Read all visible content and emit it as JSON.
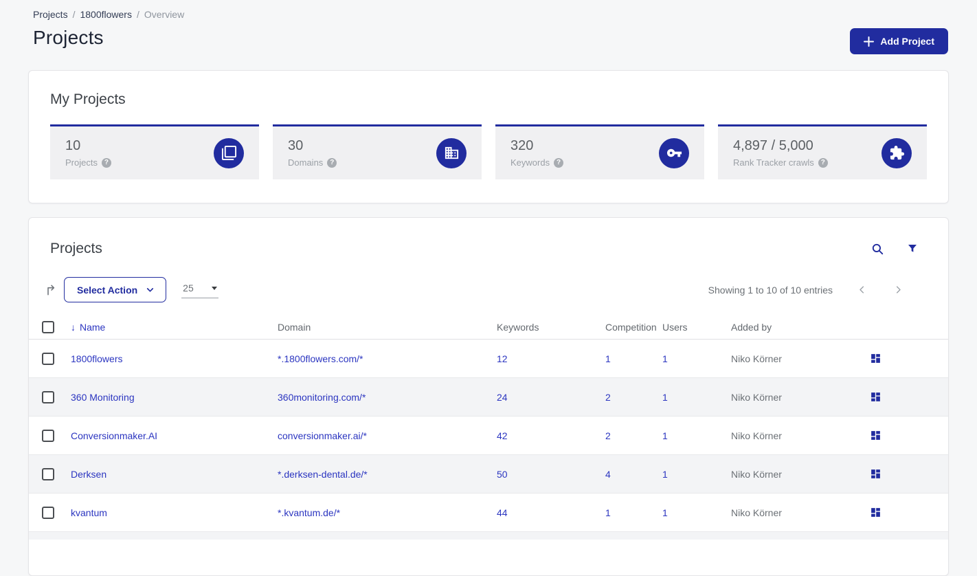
{
  "breadcrumb": {
    "items": [
      {
        "label": "Projects"
      },
      {
        "label": "1800flowers"
      },
      {
        "label": "Overview"
      }
    ],
    "separator": "/"
  },
  "header": {
    "title": "Projects",
    "add_button_label": "Add Project",
    "add_button_icon": "plus-icon"
  },
  "my_projects": {
    "title": "My Projects",
    "stats": [
      {
        "value": "10",
        "label": "Projects",
        "icon": "copy-layers-icon"
      },
      {
        "value": "30",
        "label": "Domains",
        "icon": "building-icon"
      },
      {
        "value": "320",
        "label": "Keywords",
        "icon": "key-icon"
      },
      {
        "value": "4,897 / 5,000",
        "label": "Rank Tracker crawls",
        "icon": "puzzle-icon"
      }
    ]
  },
  "projects_table": {
    "title": "Projects",
    "icons": [
      "search-icon",
      "filter-icon"
    ],
    "toolbar": {
      "export_icon": "export-arrow-icon",
      "action_select_label": "Select Action",
      "page_size_value": "25",
      "showing_text": "Showing 1 to 10 of 10 entries",
      "pager_icons": [
        "chevron-left-icon",
        "chevron-right-icon"
      ]
    },
    "columns": [
      "Name",
      "Domain",
      "Keywords",
      "Competition",
      "Users",
      "Added by"
    ],
    "sorted_column": "Name",
    "rows": [
      {
        "name": "1800flowers",
        "domain": "*.1800flowers.com/*",
        "keywords": "12",
        "competition": "1",
        "users": "1",
        "added_by": "Niko Körner"
      },
      {
        "name": "360 Monitoring",
        "domain": "360monitoring.com/*",
        "keywords": "24",
        "competition": "2",
        "users": "1",
        "added_by": "Niko Körner"
      },
      {
        "name": "Conversionmaker.AI",
        "domain": "conversionmaker.ai/*",
        "keywords": "42",
        "competition": "2",
        "users": "1",
        "added_by": "Niko Körner"
      },
      {
        "name": "Derksen",
        "domain": "*.derksen-dental.de/*",
        "keywords": "50",
        "competition": "4",
        "users": "1",
        "added_by": "Niko Körner"
      },
      {
        "name": "kvantum",
        "domain": "*.kvantum.de/*",
        "keywords": "44",
        "competition": "1",
        "users": "1",
        "added_by": "Niko Körner"
      }
    ]
  },
  "colors": {
    "accent": "#212c9f",
    "link": "#2b35c0",
    "page_bg": "#f6f7f8",
    "tile_bg": "#f0f0f2",
    "text_dark": "#1d2434",
    "text_gray": "#6b7075",
    "text_light": "#9ba0a6"
  }
}
